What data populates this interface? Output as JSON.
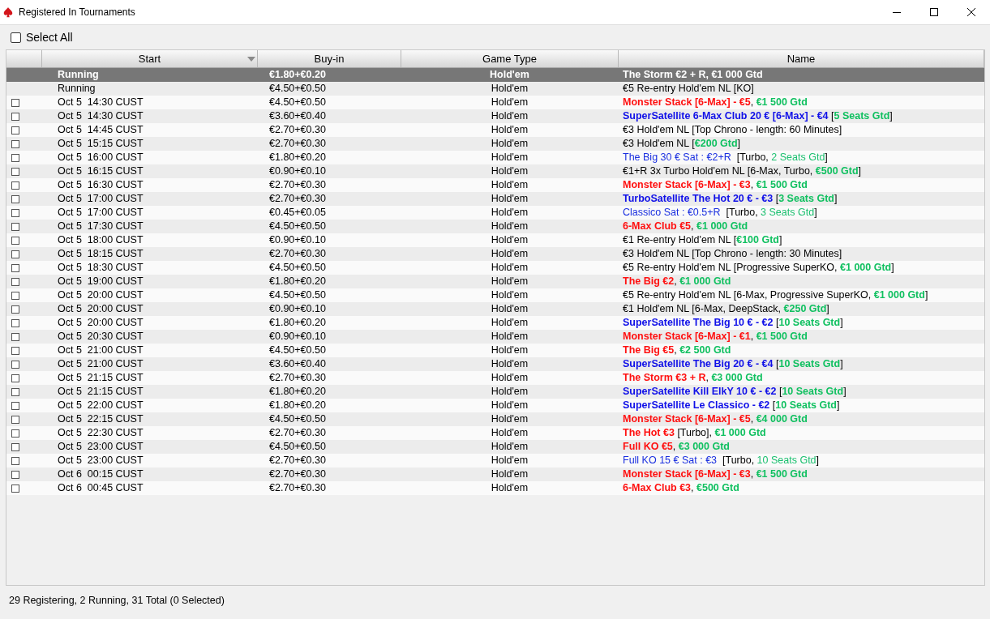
{
  "window": {
    "title": "Registered In Tournaments"
  },
  "select_all": {
    "label": "Select All",
    "checked": false
  },
  "table": {
    "columns": [
      {
        "sorted": false
      },
      {
        "label": "Start",
        "sorted": true
      },
      {
        "label": "Buy-in",
        "sorted": false
      },
      {
        "label": "Game Type",
        "sorted": false
      },
      {
        "label": "Name",
        "sorted": false
      }
    ],
    "rows": [
      {
        "selected": true,
        "start": "Running",
        "buyin": "€1.80+€0.20",
        "game_type": "Hold'em",
        "name": [
          {
            "kind": "event",
            "text": "The Storm €2 + R"
          },
          {
            "kind": "text",
            "text": ", "
          },
          {
            "kind": "guarantee",
            "text": "€1 000 Gtd"
          }
        ]
      },
      {
        "selected": false,
        "start": "Running",
        "buyin": "€4.50+€0.50",
        "game_type": "Hold'em",
        "name": [
          {
            "kind": "text",
            "text": "€5 Re-entry Hold'em NL [KO]"
          }
        ]
      },
      {
        "selected": false,
        "checked": false,
        "start": "Oct 5  14:30 CUST",
        "buyin": "€4.50+€0.50",
        "game_type": "Hold'em",
        "name": [
          {
            "kind": "event",
            "text": "Monster Stack [6-Max] - €5"
          },
          {
            "kind": "text",
            "text": ", "
          },
          {
            "kind": "guarantee",
            "text": "€1 500 Gtd"
          }
        ]
      },
      {
        "selected": false,
        "checked": false,
        "start": "Oct 5  14:30 CUST",
        "buyin": "€3.60+€0.40",
        "game_type": "Hold'em",
        "name": [
          {
            "kind": "satellite",
            "text": "SuperSatellite 6-Max Club 20 € [6-Max] - €4"
          },
          {
            "kind": "text",
            "text": " ["
          },
          {
            "kind": "guarantee",
            "text": "5 Seats Gtd"
          },
          {
            "kind": "text",
            "text": "]"
          }
        ]
      },
      {
        "selected": false,
        "checked": false,
        "start": "Oct 5  14:45 CUST",
        "buyin": "€2.70+€0.30",
        "game_type": "Hold'em",
        "name": [
          {
            "kind": "text",
            "text": "€3 Hold'em NL [Top Chrono - length: 60 Minutes]"
          }
        ]
      },
      {
        "selected": false,
        "checked": false,
        "start": "Oct 5  15:15 CUST",
        "buyin": "€2.70+€0.30",
        "game_type": "Hold'em",
        "name": [
          {
            "kind": "text",
            "text": "€3 Hold'em NL ["
          },
          {
            "kind": "guarantee",
            "text": "€200 Gtd"
          },
          {
            "kind": "text",
            "text": "]"
          }
        ]
      },
      {
        "selected": false,
        "checked": false,
        "start": "Oct 5  16:00 CUST",
        "buyin": "€1.80+€0.20",
        "game_type": "Hold'em",
        "name": [
          {
            "kind": "qualifier",
            "text": "The Big 30 € Sat : €2+R"
          },
          {
            "kind": "text",
            "text": "  [Turbo, "
          },
          {
            "kind": "seats",
            "text": "2 Seats Gtd"
          },
          {
            "kind": "text",
            "text": "]"
          }
        ]
      },
      {
        "selected": false,
        "checked": false,
        "start": "Oct 5  16:15 CUST",
        "buyin": "€0.90+€0.10",
        "game_type": "Hold'em",
        "name": [
          {
            "kind": "text",
            "text": "€1+R 3x Turbo Hold'em NL [6-Max, Turbo, "
          },
          {
            "kind": "guarantee",
            "text": "€500 Gtd"
          },
          {
            "kind": "text",
            "text": "]"
          }
        ]
      },
      {
        "selected": false,
        "checked": false,
        "start": "Oct 5  16:30 CUST",
        "buyin": "€2.70+€0.30",
        "game_type": "Hold'em",
        "name": [
          {
            "kind": "event",
            "text": "Monster Stack [6-Max] - €3"
          },
          {
            "kind": "text",
            "text": ", "
          },
          {
            "kind": "guarantee",
            "text": "€1 500 Gtd"
          }
        ]
      },
      {
        "selected": false,
        "checked": false,
        "start": "Oct 5  17:00 CUST",
        "buyin": "€2.70+€0.30",
        "game_type": "Hold'em",
        "name": [
          {
            "kind": "satellite",
            "text": "TurboSatellite The Hot 20 € - €3"
          },
          {
            "kind": "text",
            "text": " ["
          },
          {
            "kind": "guarantee",
            "text": "3 Seats Gtd"
          },
          {
            "kind": "text",
            "text": "]"
          }
        ]
      },
      {
        "selected": false,
        "checked": false,
        "start": "Oct 5  17:00 CUST",
        "buyin": "€0.45+€0.05",
        "game_type": "Hold'em",
        "name": [
          {
            "kind": "qualifier",
            "text": "Classico Sat : €0.5+R"
          },
          {
            "kind": "text",
            "text": "  [Turbo, "
          },
          {
            "kind": "seats",
            "text": "3 Seats Gtd"
          },
          {
            "kind": "text",
            "text": "]"
          }
        ]
      },
      {
        "selected": false,
        "checked": false,
        "start": "Oct 5  17:30 CUST",
        "buyin": "€4.50+€0.50",
        "game_type": "Hold'em",
        "name": [
          {
            "kind": "event",
            "text": "6-Max Club €5"
          },
          {
            "kind": "text",
            "text": ", "
          },
          {
            "kind": "guarantee",
            "text": "€1 000 Gtd"
          }
        ]
      },
      {
        "selected": false,
        "checked": false,
        "start": "Oct 5  18:00 CUST",
        "buyin": "€0.90+€0.10",
        "game_type": "Hold'em",
        "name": [
          {
            "kind": "text",
            "text": "€1 Re-entry Hold'em NL ["
          },
          {
            "kind": "guarantee",
            "text": "€100 Gtd"
          },
          {
            "kind": "text",
            "text": "]"
          }
        ]
      },
      {
        "selected": false,
        "checked": false,
        "start": "Oct 5  18:15 CUST",
        "buyin": "€2.70+€0.30",
        "game_type": "Hold'em",
        "name": [
          {
            "kind": "text",
            "text": "€3 Hold'em NL [Top Chrono - length: 30 Minutes]"
          }
        ]
      },
      {
        "selected": false,
        "checked": false,
        "start": "Oct 5  18:30 CUST",
        "buyin": "€4.50+€0.50",
        "game_type": "Hold'em",
        "name": [
          {
            "kind": "text",
            "text": "€5 Re-entry Hold'em NL [Progressive SuperKO, "
          },
          {
            "kind": "guarantee",
            "text": "€1 000 Gtd"
          },
          {
            "kind": "text",
            "text": "]"
          }
        ]
      },
      {
        "selected": false,
        "checked": false,
        "start": "Oct 5  19:00 CUST",
        "buyin": "€1.80+€0.20",
        "game_type": "Hold'em",
        "name": [
          {
            "kind": "event",
            "text": "The Big €2"
          },
          {
            "kind": "text",
            "text": ", "
          },
          {
            "kind": "guarantee",
            "text": "€1 000 Gtd"
          }
        ]
      },
      {
        "selected": false,
        "checked": false,
        "start": "Oct 5  20:00 CUST",
        "buyin": "€4.50+€0.50",
        "game_type": "Hold'em",
        "name": [
          {
            "kind": "text",
            "text": "€5 Re-entry Hold'em NL [6-Max, Progressive SuperKO, "
          },
          {
            "kind": "guarantee",
            "text": "€1 000 Gtd"
          },
          {
            "kind": "text",
            "text": "]"
          }
        ]
      },
      {
        "selected": false,
        "checked": false,
        "start": "Oct 5  20:00 CUST",
        "buyin": "€0.90+€0.10",
        "game_type": "Hold'em",
        "name": [
          {
            "kind": "text",
            "text": "€1 Hold'em NL [6-Max, DeepStack, "
          },
          {
            "kind": "guarantee",
            "text": "€250 Gtd"
          },
          {
            "kind": "text",
            "text": "]"
          }
        ]
      },
      {
        "selected": false,
        "checked": false,
        "start": "Oct 5  20:00 CUST",
        "buyin": "€1.80+€0.20",
        "game_type": "Hold'em",
        "name": [
          {
            "kind": "satellite",
            "text": "SuperSatellite The Big 10 € - €2"
          },
          {
            "kind": "text",
            "text": " ["
          },
          {
            "kind": "guarantee",
            "text": "10 Seats Gtd"
          },
          {
            "kind": "text",
            "text": "]"
          }
        ]
      },
      {
        "selected": false,
        "checked": false,
        "start": "Oct 5  20:30 CUST",
        "buyin": "€0.90+€0.10",
        "game_type": "Hold'em",
        "name": [
          {
            "kind": "event",
            "text": "Monster Stack [6-Max] - €1"
          },
          {
            "kind": "text",
            "text": ", "
          },
          {
            "kind": "guarantee",
            "text": "€1 500 Gtd"
          }
        ]
      },
      {
        "selected": false,
        "checked": false,
        "start": "Oct 5  21:00 CUST",
        "buyin": "€4.50+€0.50",
        "game_type": "Hold'em",
        "name": [
          {
            "kind": "event",
            "text": "The Big €5"
          },
          {
            "kind": "text",
            "text": ", "
          },
          {
            "kind": "guarantee",
            "text": "€2 500 Gtd"
          }
        ]
      },
      {
        "selected": false,
        "checked": false,
        "start": "Oct 5  21:00 CUST",
        "buyin": "€3.60+€0.40",
        "game_type": "Hold'em",
        "name": [
          {
            "kind": "satellite",
            "text": "SuperSatellite The Big 20 € - €4"
          },
          {
            "kind": "text",
            "text": " ["
          },
          {
            "kind": "guarantee",
            "text": "10 Seats Gtd"
          },
          {
            "kind": "text",
            "text": "]"
          }
        ]
      },
      {
        "selected": false,
        "checked": false,
        "start": "Oct 5  21:15 CUST",
        "buyin": "€2.70+€0.30",
        "game_type": "Hold'em",
        "name": [
          {
            "kind": "event",
            "text": "The Storm €3 + R"
          },
          {
            "kind": "text",
            "text": ", "
          },
          {
            "kind": "guarantee",
            "text": "€3 000 Gtd"
          }
        ]
      },
      {
        "selected": false,
        "checked": false,
        "start": "Oct 5  21:15 CUST",
        "buyin": "€1.80+€0.20",
        "game_type": "Hold'em",
        "name": [
          {
            "kind": "satellite",
            "text": "SuperSatellite Kill ElkY 10 € - €2"
          },
          {
            "kind": "text",
            "text": " ["
          },
          {
            "kind": "guarantee",
            "text": "10 Seats Gtd"
          },
          {
            "kind": "text",
            "text": "]"
          }
        ]
      },
      {
        "selected": false,
        "checked": false,
        "start": "Oct 5  22:00 CUST",
        "buyin": "€1.80+€0.20",
        "game_type": "Hold'em",
        "name": [
          {
            "kind": "satellite",
            "text": "SuperSatellite Le Classico - €2"
          },
          {
            "kind": "text",
            "text": " ["
          },
          {
            "kind": "guarantee",
            "text": "10 Seats Gtd"
          },
          {
            "kind": "text",
            "text": "]"
          }
        ]
      },
      {
        "selected": false,
        "checked": false,
        "start": "Oct 5  22:15 CUST",
        "buyin": "€4.50+€0.50",
        "game_type": "Hold'em",
        "name": [
          {
            "kind": "event",
            "text": "Monster Stack [6-Max] - €5"
          },
          {
            "kind": "text",
            "text": ", "
          },
          {
            "kind": "guarantee",
            "text": "€4 000 Gtd"
          }
        ]
      },
      {
        "selected": false,
        "checked": false,
        "start": "Oct 5  22:30 CUST",
        "buyin": "€2.70+€0.30",
        "game_type": "Hold'em",
        "name": [
          {
            "kind": "event",
            "text": "The Hot €3"
          },
          {
            "kind": "text",
            "text": " [Turbo], "
          },
          {
            "kind": "guarantee",
            "text": "€1 000 Gtd"
          }
        ]
      },
      {
        "selected": false,
        "checked": false,
        "start": "Oct 5  23:00 CUST",
        "buyin": "€4.50+€0.50",
        "game_type": "Hold'em",
        "name": [
          {
            "kind": "event",
            "text": "Full KO €5"
          },
          {
            "kind": "text",
            "text": ", "
          },
          {
            "kind": "guarantee",
            "text": "€3 000 Gtd"
          }
        ]
      },
      {
        "selected": false,
        "checked": false,
        "start": "Oct 5  23:00 CUST",
        "buyin": "€2.70+€0.30",
        "game_type": "Hold'em",
        "name": [
          {
            "kind": "qualifier",
            "text": "Full KO 15 € Sat : €3"
          },
          {
            "kind": "text",
            "text": "  [Turbo, "
          },
          {
            "kind": "seats",
            "text": "10 Seats Gtd"
          },
          {
            "kind": "text",
            "text": "]"
          }
        ]
      },
      {
        "selected": false,
        "checked": false,
        "start": "Oct 6  00:15 CUST",
        "buyin": "€2.70+€0.30",
        "game_type": "Hold'em",
        "name": [
          {
            "kind": "event",
            "text": "Monster Stack [6-Max] - €3"
          },
          {
            "kind": "text",
            "text": ", "
          },
          {
            "kind": "guarantee",
            "text": "€1 500 Gtd"
          }
        ]
      },
      {
        "selected": false,
        "checked": false,
        "start": "Oct 6  00:45 CUST",
        "buyin": "€2.70+€0.30",
        "game_type": "Hold'em",
        "name": [
          {
            "kind": "event",
            "text": "6-Max Club €3"
          },
          {
            "kind": "text",
            "text": ", "
          },
          {
            "kind": "guarantee",
            "text": "€500 Gtd"
          }
        ]
      }
    ]
  },
  "status_bar": {
    "text": "29 Registering, 2 Running, 31 Total (0 Selected)"
  }
}
